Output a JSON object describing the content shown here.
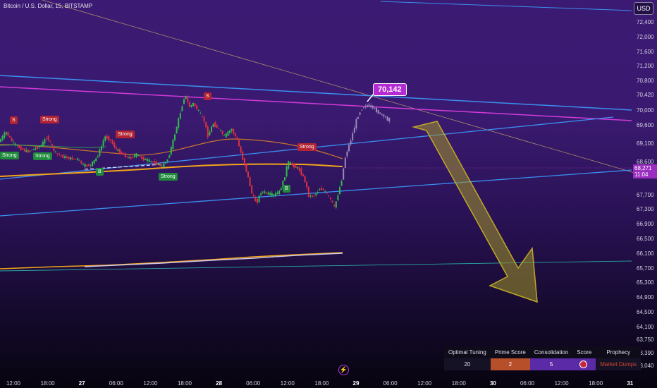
{
  "header": {
    "title": "Bitcoin / U.S. Dollar, 15, BITSTAMP",
    "currency": "USD"
  },
  "chart_data": {
    "type": "candlestick",
    "y_ticks": [
      "72,400",
      "72,000",
      "71,600",
      "71,200",
      "70,800",
      "70,420",
      "70,000",
      "69,600",
      "69,100",
      "68,600",
      "68,271",
      "67,700",
      "67,300",
      "66,900",
      "66,500",
      "66,100",
      "65,700",
      "65,300",
      "64,900",
      "64,500",
      "64,100",
      "63,750",
      "63,390",
      "63,040"
    ],
    "x_ticks": [
      {
        "label": "12:00",
        "bold": false
      },
      {
        "label": "18:00",
        "bold": false
      },
      {
        "label": "27",
        "bold": true
      },
      {
        "label": "06:00",
        "bold": false
      },
      {
        "label": "12:00",
        "bold": false
      },
      {
        "label": "18:00",
        "bold": false
      },
      {
        "label": "28",
        "bold": true
      },
      {
        "label": "06:00",
        "bold": false
      },
      {
        "label": "12:00",
        "bold": false
      },
      {
        "label": "18:00",
        "bold": false
      },
      {
        "label": "29",
        "bold": true
      },
      {
        "label": "06:00",
        "bold": false
      },
      {
        "label": "12:00",
        "bold": false
      },
      {
        "label": "18:00",
        "bold": false
      },
      {
        "label": "30",
        "bold": true
      },
      {
        "label": "06:00",
        "bold": false
      },
      {
        "label": "12:00",
        "bold": false
      },
      {
        "label": "18:00",
        "bold": false
      },
      {
        "label": "31",
        "bold": true
      }
    ],
    "ylim": [
      62900,
      72700
    ],
    "price_path": [
      [
        0,
        69150
      ],
      [
        10,
        69420
      ],
      [
        20,
        69120
      ],
      [
        30,
        68980
      ],
      [
        40,
        68880
      ],
      [
        50,
        68960
      ],
      [
        60,
        69050
      ],
      [
        68,
        69300
      ],
      [
        80,
        68850
      ],
      [
        90,
        68750
      ],
      [
        100,
        68700
      ],
      [
        112,
        68680
      ],
      [
        120,
        68500
      ],
      [
        130,
        68520
      ],
      [
        138,
        68700
      ],
      [
        146,
        69050
      ],
      [
        150,
        69300
      ],
      [
        158,
        69200
      ],
      [
        166,
        68950
      ],
      [
        175,
        68820
      ],
      [
        185,
        68700
      ],
      [
        195,
        68800
      ],
      [
        205,
        68680
      ],
      [
        215,
        68620
      ],
      [
        225,
        68550
      ],
      [
        232,
        68480
      ],
      [
        240,
        68700
      ],
      [
        246,
        69100
      ],
      [
        252,
        69550
      ],
      [
        258,
        70000
      ],
      [
        264,
        70450
      ],
      [
        270,
        70100
      ],
      [
        276,
        70200
      ],
      [
        284,
        69950
      ],
      [
        292,
        69700
      ],
      [
        296,
        69300
      ],
      [
        304,
        69650
      ],
      [
        312,
        69500
      ],
      [
        320,
        69300
      ],
      [
        330,
        69500
      ],
      [
        338,
        69200
      ],
      [
        344,
        68800
      ],
      [
        352,
        68300
      ],
      [
        360,
        67650
      ],
      [
        366,
        67500
      ],
      [
        372,
        67800
      ],
      [
        380,
        67750
      ],
      [
        390,
        67700
      ],
      [
        398,
        67800
      ],
      [
        404,
        68100
      ],
      [
        410,
        68600
      ],
      [
        418,
        68500
      ],
      [
        426,
        68400
      ],
      [
        434,
        68100
      ],
      [
        440,
        67650
      ],
      [
        448,
        67700
      ],
      [
        456,
        67900
      ],
      [
        462,
        67800
      ],
      [
        470,
        67600
      ],
      [
        476,
        67350
      ],
      [
        480,
        67650
      ],
      [
        486,
        68100
      ],
      [
        492,
        68800
      ],
      [
        500,
        69250
      ],
      [
        508,
        69800
      ],
      [
        514,
        70050
      ],
      [
        522,
        70150
      ],
      [
        530,
        70100
      ],
      [
        538,
        69950
      ],
      [
        546,
        69850
      ],
      [
        552,
        69750
      ]
    ],
    "callout_price": "70,142",
    "current_price": "68,271",
    "current_time": "11:04",
    "signals": [
      {
        "text": "S",
        "kind": "sell"
      },
      {
        "text": "Strong",
        "kind": "sell"
      },
      {
        "text": "Strong",
        "kind": "buy"
      },
      {
        "text": "Strong",
        "kind": "buy"
      },
      {
        "text": "Strong",
        "kind": "sell"
      },
      {
        "text": "B",
        "kind": "buy"
      },
      {
        "text": "Strong",
        "kind": "buy"
      },
      {
        "text": "S",
        "kind": "sell"
      },
      {
        "text": "Strong",
        "kind": "sell"
      },
      {
        "text": "B",
        "kind": "buy"
      }
    ],
    "colors": {
      "up": "#2fbf4a",
      "down": "#e0303f",
      "projection": "#9a8aba",
      "trend_blue": "#3a8ff0",
      "trend_magenta": "#d23ad8",
      "ma_orange": "#f2a51a",
      "arrow": "#b8a02a"
    }
  },
  "table": {
    "headers": [
      "Optimal Tuning",
      "Prime Score",
      "Consolidation",
      "Score",
      "Prophecy"
    ],
    "values": [
      "20",
      "2",
      "5",
      "",
      "Market Dumps"
    ]
  },
  "footer": {
    "bolt_icon": "⚡"
  }
}
